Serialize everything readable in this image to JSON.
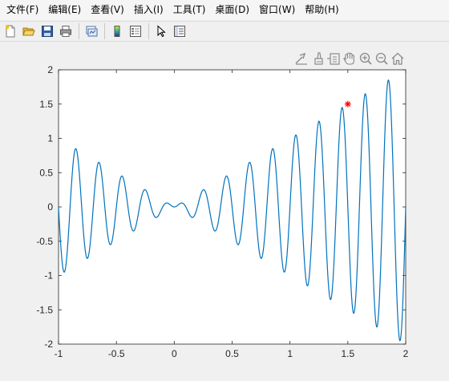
{
  "menu": {
    "items": [
      {
        "label": "文件(F)"
      },
      {
        "label": "编辑(E)"
      },
      {
        "label": "查看(V)"
      },
      {
        "label": "插入(I)"
      },
      {
        "label": "工具(T)"
      },
      {
        "label": "桌面(D)"
      },
      {
        "label": "窗口(W)"
      },
      {
        "label": "帮助(H)"
      }
    ]
  },
  "toolbar": {
    "icons": [
      "new-figure-icon",
      "open-file-icon",
      "save-icon",
      "print-icon",
      "link-plot-icon",
      "insert-colorbar-icon",
      "insert-legend-icon",
      "edit-plot-pointer-icon",
      "property-inspector-icon"
    ]
  },
  "axes_toolbar": {
    "icons": [
      "export-icon",
      "brush-icon",
      "data-tips-icon",
      "pan-hand-icon",
      "zoom-in-icon",
      "zoom-out-icon",
      "restore-view-icon"
    ]
  },
  "colors": {
    "line": "#0072bd",
    "marker": "#ff0000",
    "axes_bg": "#ffffff",
    "axes_edge": "#262626"
  },
  "chart_data": {
    "type": "line",
    "title": "",
    "xlabel": "",
    "ylabel": "",
    "xlim": [
      -1,
      2
    ],
    "ylim": [
      -2,
      2
    ],
    "xticks": [
      -1,
      -0.5,
      0,
      0.5,
      1,
      1.5,
      2
    ],
    "xtick_labels": [
      "-1",
      "-0.5",
      "0",
      "0.5",
      "1",
      "1.5",
      "2"
    ],
    "yticks": [
      -2,
      -1.5,
      -1,
      -0.5,
      0,
      0.5,
      1,
      1.5,
      2
    ],
    "ytick_labels": [
      "-2",
      "-1.5",
      "-1",
      "-0.5",
      "0",
      "0.5",
      "1",
      "1.5",
      "2"
    ],
    "grid": false,
    "series": [
      {
        "function": "x*sin(10*pi*x)+1",
        "x_range": [
          -1,
          2
        ],
        "y_offset": -1,
        "color": "#0072bd"
      }
    ],
    "marker": {
      "x": 1.5,
      "y": 1.5,
      "symbol": "*",
      "color": "#ff0000"
    }
  }
}
